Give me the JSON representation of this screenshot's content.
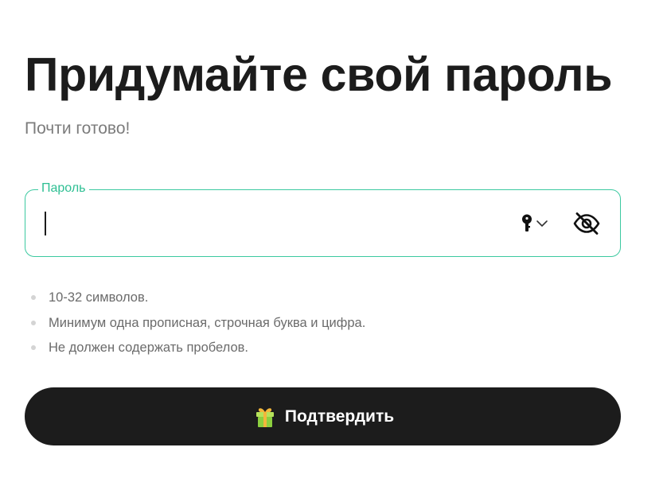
{
  "page": {
    "title": "Придумайте свой пароль",
    "subtitle": "Почти готово!"
  },
  "password_field": {
    "label": "Пароль",
    "value": "",
    "key_icon": "key-icon",
    "dropdown_icon": "chevron-down-icon",
    "visibility_icon": "eye-off-icon"
  },
  "requirements": [
    "10-32 символов.",
    "Минимум одна прописная, строчная буква и цифра.",
    "Не должен содержать пробелов."
  ],
  "submit": {
    "label": "Подтвердить",
    "icon": "gift-icon"
  },
  "colors": {
    "accent": "#3cc9a0",
    "button_bg": "#1c1c1c",
    "text_primary": "#1c1c1c",
    "text_secondary": "#7c7c7c"
  }
}
